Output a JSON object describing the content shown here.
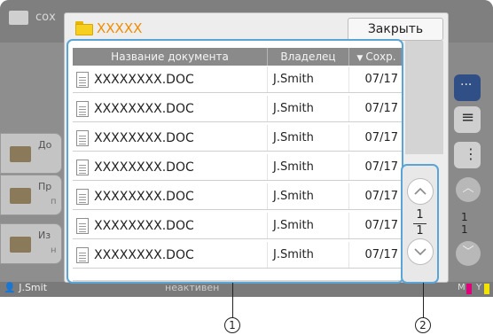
{
  "background": {
    "folder_title_fragment": "сох",
    "left_buttons": [
      {
        "label": "До",
        "sub": "",
        "icon": "add-folder-icon"
      },
      {
        "label": "Пр",
        "sub": "п",
        "icon": "folder-icon"
      },
      {
        "label": "Из",
        "sub": "н",
        "icon": "edit-document-icon"
      }
    ],
    "page_counter": {
      "current": "1",
      "total": "1"
    },
    "status_user": "J.Smit",
    "status_middle": "неактивен",
    "ink_letters": [
      "M",
      "Y"
    ]
  },
  "dialog": {
    "folder_name": "XXXXX",
    "close_label": "Закрыть",
    "columns": {
      "name": "Название документа",
      "owner": "Владелец",
      "date": "Сохр."
    },
    "sort_indicator": "▼",
    "rows": [
      {
        "name": "XXXXXXXX.DOC",
        "owner": "J.Smith",
        "date": "07/17"
      },
      {
        "name": "XXXXXXXX.DOC",
        "owner": "J.Smith",
        "date": "07/17"
      },
      {
        "name": "XXXXXXXX.DOC",
        "owner": "J.Smith",
        "date": "07/17"
      },
      {
        "name": "XXXXXXXX.DOC",
        "owner": "J.Smith",
        "date": "07/17"
      },
      {
        "name": "XXXXXXXX.DOC",
        "owner": "J.Smith",
        "date": "07/17"
      },
      {
        "name": "XXXXXXXX.DOC",
        "owner": "J.Smith",
        "date": "07/17"
      },
      {
        "name": "XXXXXXXX.DOC",
        "owner": "J.Smith",
        "date": "07/17"
      }
    ],
    "pager": {
      "current": "1",
      "total": "1"
    }
  },
  "callouts": [
    "1",
    "2"
  ],
  "colors": {
    "highlight_border": "#5aa5d6",
    "folder_title": "#f08c00",
    "header_bg": "#8a8a8a"
  }
}
